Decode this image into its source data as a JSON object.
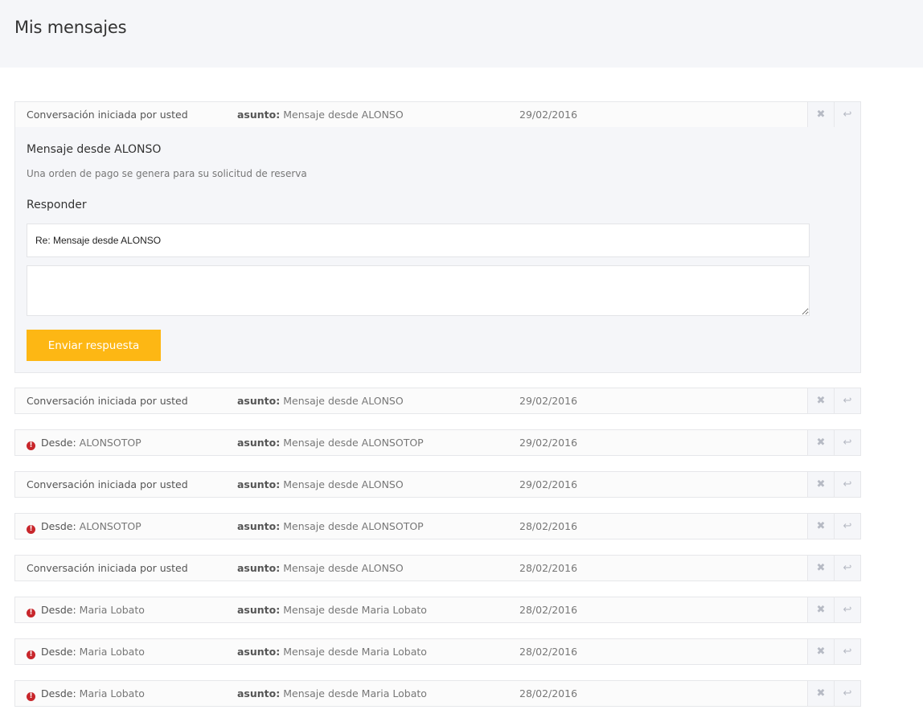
{
  "page": {
    "title": "Mis mensajes"
  },
  "labels": {
    "initiated": "Conversación iniciada por usted",
    "from": "Desde:",
    "subject": "asunto:"
  },
  "icons": {
    "delete": "close-icon",
    "reply": "reply-icon",
    "unread": "alert-icon"
  },
  "colors": {
    "accent": "#fdb714",
    "unread": "#c8262b",
    "header_bg": "#f5f6f9"
  },
  "expanded": {
    "row": {
      "from_text": "Conversación iniciada por usted",
      "subject": "Mensaje desde ALONSO",
      "date": "29/02/2016"
    },
    "body_subject": "Mensaje desde ALONSO",
    "body_text": "Una orden de pago se genera para su solicitud de reserva",
    "reply_title": "Responder",
    "reply_subject_value": "Re: Mensaje desde ALONSO",
    "reply_body_value": "",
    "send_label": "Enviar respuesta"
  },
  "messages": [
    {
      "type": "sent",
      "from": "",
      "subject": "Mensaje desde ALONSO",
      "date": "29/02/2016"
    },
    {
      "type": "received",
      "from": "ALONSOTOP",
      "subject": "Mensaje desde ALONSOTOP",
      "date": "29/02/2016"
    },
    {
      "type": "sent",
      "from": "",
      "subject": "Mensaje desde ALONSO",
      "date": "29/02/2016"
    },
    {
      "type": "received",
      "from": "ALONSOTOP",
      "subject": "Mensaje desde ALONSOTOP",
      "date": "28/02/2016"
    },
    {
      "type": "sent",
      "from": "",
      "subject": "Mensaje desde ALONSO",
      "date": "28/02/2016"
    },
    {
      "type": "received",
      "from": "Maria Lobato",
      "subject": "Mensaje desde Maria Lobato",
      "date": "28/02/2016"
    },
    {
      "type": "received",
      "from": "Maria Lobato",
      "subject": "Mensaje desde Maria Lobato",
      "date": "28/02/2016"
    },
    {
      "type": "received",
      "from": "Maria Lobato",
      "subject": "Mensaje desde Maria Lobato",
      "date": "28/02/2016"
    }
  ]
}
